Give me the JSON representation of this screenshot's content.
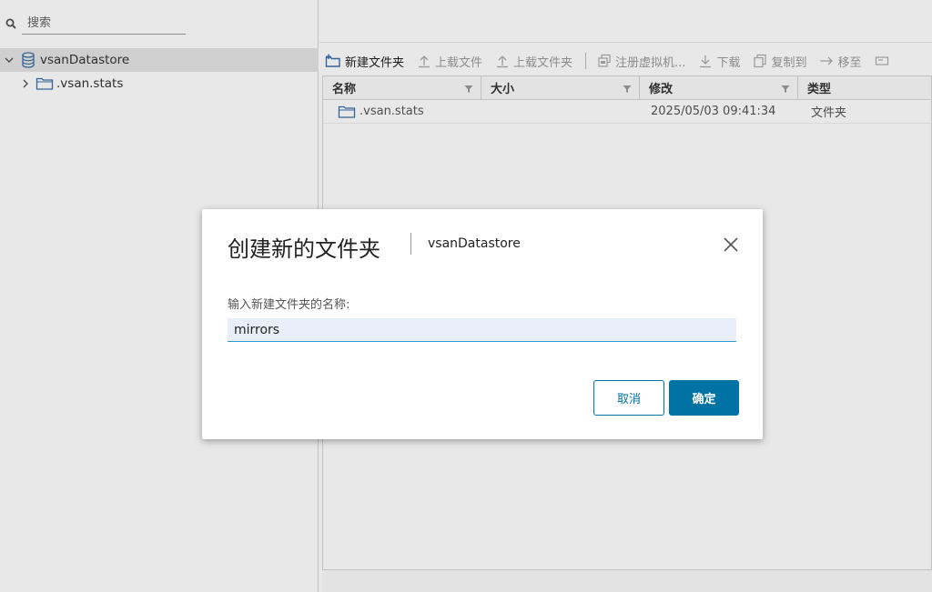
{
  "search": {
    "placeholder": "搜索"
  },
  "tree": {
    "root": {
      "label": "vsanDatastore",
      "icon": "database-icon"
    },
    "children": [
      {
        "label": ".vsan.stats",
        "icon": "folder-icon"
      }
    ]
  },
  "toolbar": {
    "new_folder": "新建文件夹",
    "upload_file": "上载文件",
    "upload_folder": "上载文件夹",
    "register_vm": "注册虚拟机...",
    "download": "下载",
    "copy_to": "复制到",
    "move_to": "移至"
  },
  "grid": {
    "columns": [
      "名称",
      "大小",
      "修改",
      "类型"
    ],
    "rows": [
      {
        "name": ".vsan.stats",
        "size": "",
        "modified": "2025/05/03 09:41:34",
        "type": "文件夹"
      }
    ]
  },
  "dialog": {
    "title": "创建新的文件夹",
    "subtitle": "vsanDatastore",
    "field_label": "输入新建文件夹的名称:",
    "field_value": "mirrors",
    "cancel_label": "取消",
    "ok_label": "确定"
  },
  "colors": {
    "primary": "#0072a3",
    "input_bg": "#e8eff8",
    "selection_bg": "#e4e4e4",
    "icon_blue": "#3b6ea5"
  }
}
